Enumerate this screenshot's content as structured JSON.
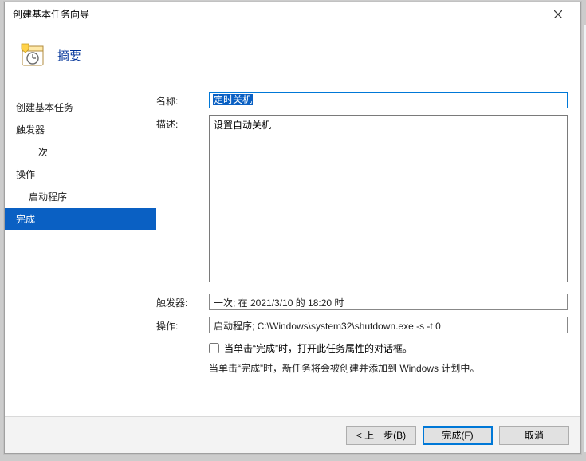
{
  "window": {
    "title": "创建基本任务向导"
  },
  "header": {
    "heading": "摘要"
  },
  "sidebar": {
    "items": [
      {
        "label": "创建基本任务",
        "sub": false,
        "selected": false
      },
      {
        "label": "触发器",
        "sub": false,
        "selected": false
      },
      {
        "label": "一次",
        "sub": true,
        "selected": false
      },
      {
        "label": "操作",
        "sub": false,
        "selected": false
      },
      {
        "label": "启动程序",
        "sub": true,
        "selected": false
      },
      {
        "label": "完成",
        "sub": false,
        "selected": true
      }
    ]
  },
  "form": {
    "name_label": "名称:",
    "name_value": "定时关机",
    "desc_label": "描述:",
    "desc_value": "设置自动关机",
    "trigger_label": "触发器:",
    "trigger_value": "一次;  在 2021/3/10 的 18:20 时",
    "action_label": "操作:",
    "action_value": "启动程序; C:\\Windows\\system32\\shutdown.exe -s -t 0",
    "checkbox_label": "当单击“完成”时，打开此任务属性的对话框。",
    "hint": "当单击“完成”时，新任务将会被创建并添加到 Windows 计划中。"
  },
  "footer": {
    "back": "<  上一步(B)",
    "finish": "完成(F)",
    "cancel": "取消"
  }
}
